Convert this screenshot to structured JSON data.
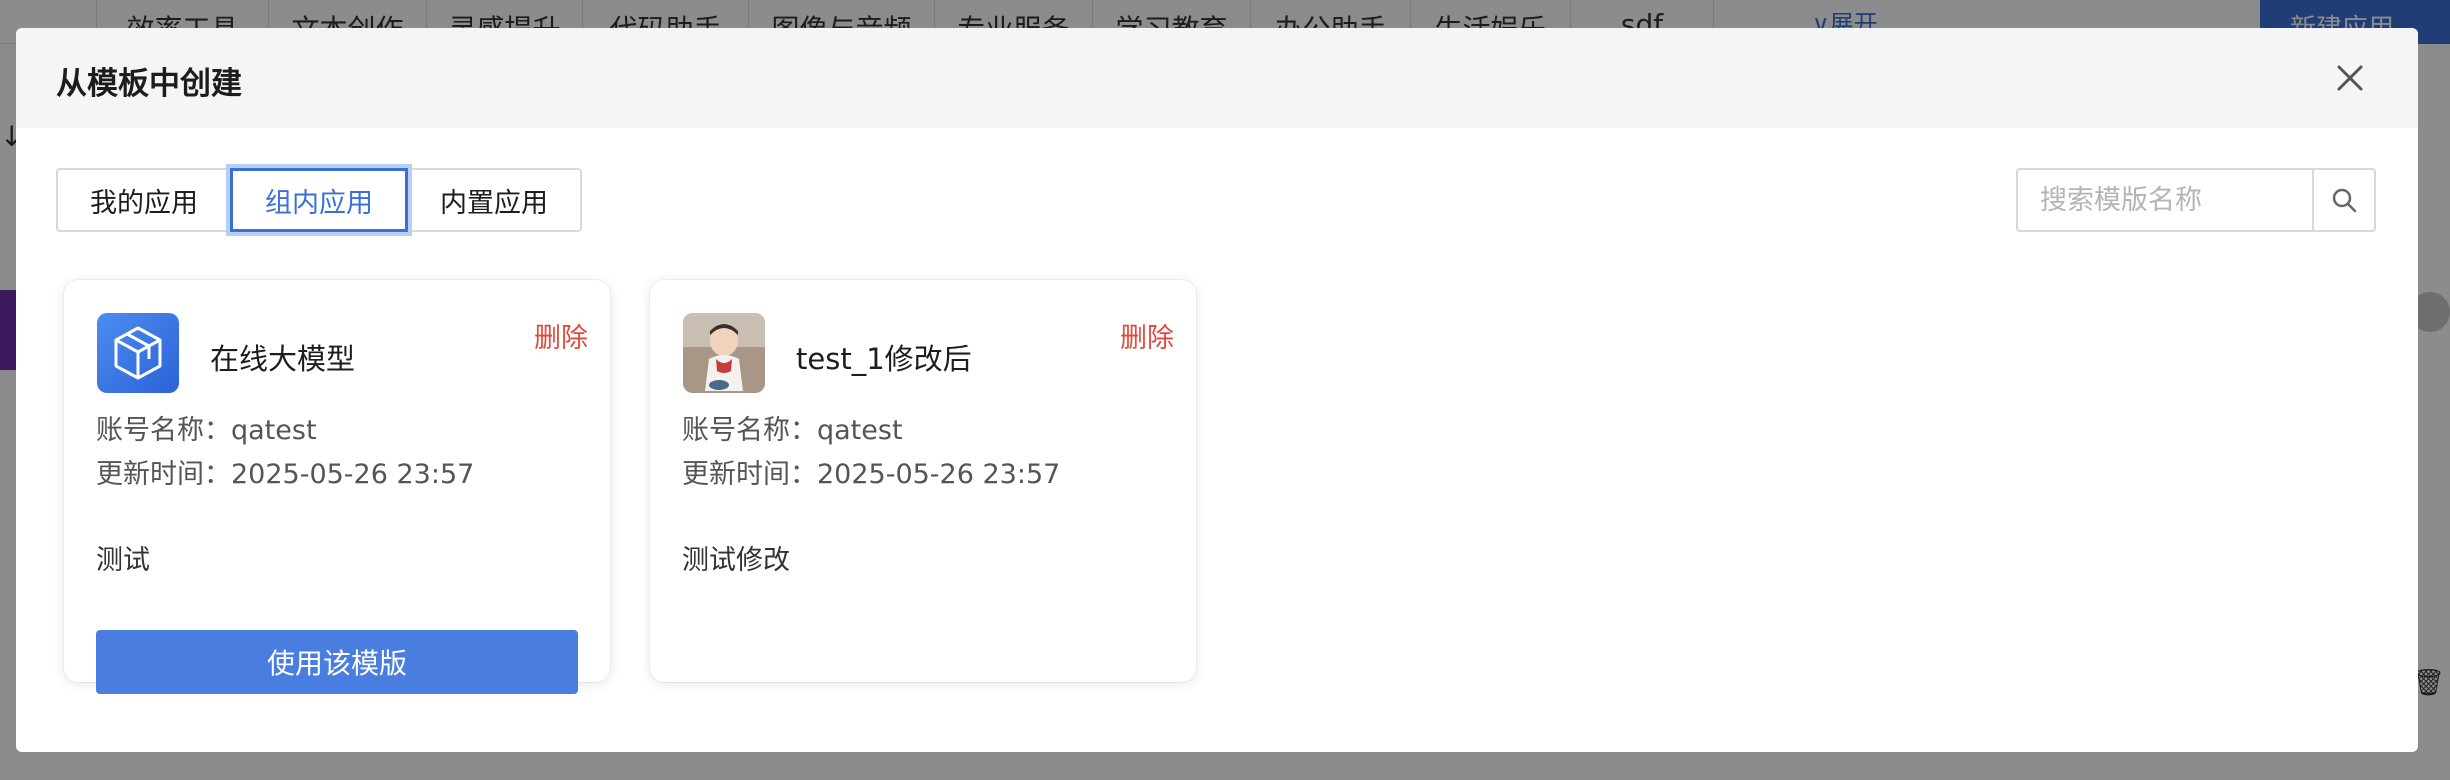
{
  "background": {
    "tabs": [
      "效率工具",
      "文本创作",
      "灵感提升",
      "代码助手",
      "图像与音频",
      "专业服务",
      "学习教育",
      "办公助手",
      "生活娱乐",
      "sdf"
    ],
    "expand_label": "展开",
    "new_app_label": "新建应用"
  },
  "modal": {
    "title": "从模板中创建",
    "tabs": [
      {
        "label": "我的应用",
        "active": false
      },
      {
        "label": "组内应用",
        "active": true
      },
      {
        "label": "内置应用",
        "active": false
      }
    ],
    "search": {
      "placeholder": "搜索模版名称",
      "value": ""
    },
    "cards": [
      {
        "name": "在线大模型",
        "icon": "cube-icon",
        "delete_label": "删除",
        "account_label": "账号名称：",
        "account": "qatest",
        "updated_label": "更新时间：",
        "updated": "2025-05-26 23:57",
        "description": "测试",
        "use_label": "使用该模版"
      },
      {
        "name": "test_1修改后",
        "icon": "baby-photo-avatar",
        "delete_label": "删除",
        "account_label": "账号名称：",
        "account": "qatest",
        "updated_label": "更新时间：",
        "updated": "2025-05-26 23:57",
        "description": "测试修改"
      }
    ]
  },
  "colors": {
    "primary": "#3b6fd8",
    "button": "#4a7de0",
    "danger": "#e5473b",
    "header_bg": "#f4f5f7"
  }
}
